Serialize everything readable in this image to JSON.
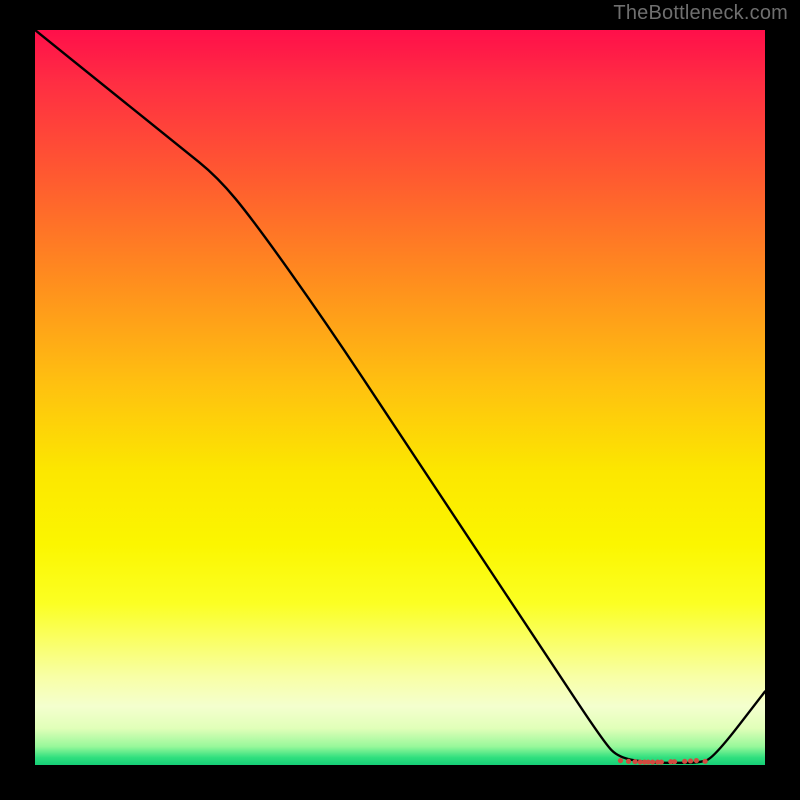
{
  "attribution": "TheBottleneck.com",
  "chart_data": {
    "type": "line",
    "title": "",
    "xlabel": "",
    "ylabel": "",
    "xlim": [
      0,
      100
    ],
    "ylim": [
      0,
      100
    ],
    "series": [
      {
        "name": "curve",
        "x": [
          0,
          10,
          20,
          25,
          30,
          40,
          50,
          60,
          70,
          78,
          80,
          84,
          88,
          91,
          93,
          100
        ],
        "y": [
          100,
          92,
          84,
          80,
          74,
          60,
          45,
          30,
          15,
          3,
          1,
          0.3,
          0.3,
          0.3,
          1,
          10
        ]
      }
    ],
    "markers": {
      "name": "bottom-dots",
      "x": [
        80.2,
        81.3,
        82.2,
        82.9,
        83.5,
        84.0,
        84.6,
        85.3,
        85.8,
        87.1,
        87.6,
        89.0,
        89.8,
        90.6,
        91.8
      ],
      "y": [
        0.6,
        0.5,
        0.45,
        0.4,
        0.4,
        0.4,
        0.4,
        0.4,
        0.4,
        0.45,
        0.45,
        0.5,
        0.55,
        0.6,
        0.5
      ]
    },
    "gradient_stops": [
      {
        "pos": 0,
        "color": "#ff0f4a"
      },
      {
        "pos": 20,
        "color": "#ff5a30"
      },
      {
        "pos": 48,
        "color": "#ffc010"
      },
      {
        "pos": 70,
        "color": "#fbf600"
      },
      {
        "pos": 92,
        "color": "#f4ffce"
      },
      {
        "pos": 100,
        "color": "#15cf77"
      }
    ]
  }
}
